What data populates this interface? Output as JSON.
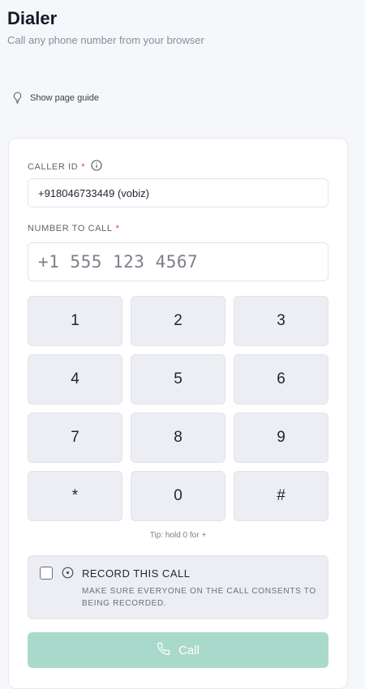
{
  "header": {
    "title": "Dialer",
    "subtitle": "Call any phone number from your browser"
  },
  "guide": {
    "label": "Show page guide",
    "icon": "lightbulb-icon"
  },
  "form": {
    "caller_id": {
      "label": "CALLER ID",
      "required_mark": "*",
      "value": "+918046733449 (vobiz)"
    },
    "number_to_call": {
      "label": "NUMBER TO CALL",
      "required_mark": "*",
      "placeholder": "+1 555 123 4567",
      "value": ""
    }
  },
  "keypad": {
    "keys": [
      "1",
      "2",
      "3",
      "4",
      "5",
      "6",
      "7",
      "8",
      "9",
      "*",
      "0",
      "#"
    ],
    "tip": "Tip: hold 0 for +"
  },
  "record": {
    "title": "RECORD THIS CALL",
    "description": "MAKE SURE EVERYONE ON THE CALL CONSENTS TO BEING RECORDED.",
    "checked": false
  },
  "call_button": {
    "label": "Call",
    "enabled": false,
    "color": "#a9d9ca"
  },
  "colors": {
    "background": "#f6f7fb",
    "card": "#ffffff",
    "key_background": "#eceef4",
    "required": "#e0364a"
  }
}
